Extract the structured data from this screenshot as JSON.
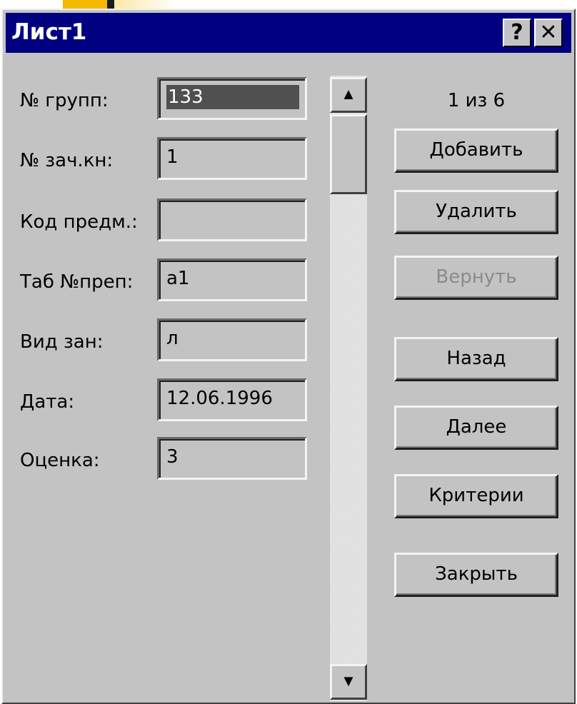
{
  "window": {
    "title": "Лист1",
    "help_label": "?",
    "close_label": "✕"
  },
  "form": {
    "fields": [
      {
        "label": "№ групп:",
        "value": "133",
        "selected": true
      },
      {
        "label": "№ зач.кн:",
        "value": "1"
      },
      {
        "label": "Код предм.:",
        "value": ""
      },
      {
        "label": "Таб №преп:",
        "value": "а1"
      },
      {
        "label": "Вид зан:",
        "value": "л"
      },
      {
        "label": "Дата:",
        "value": "12.06.1996"
      },
      {
        "label": "Оценка:",
        "value": "3"
      }
    ]
  },
  "record_counter": "1 из 6",
  "buttons": {
    "add": "Добавить",
    "delete": "Удалить",
    "restore": "Вернуть",
    "back": "Назад",
    "next": "Далее",
    "criteria": "Критерии",
    "close": "Закрыть"
  },
  "scrollbar": {
    "up_icon": "▲",
    "down_icon": "▼"
  }
}
